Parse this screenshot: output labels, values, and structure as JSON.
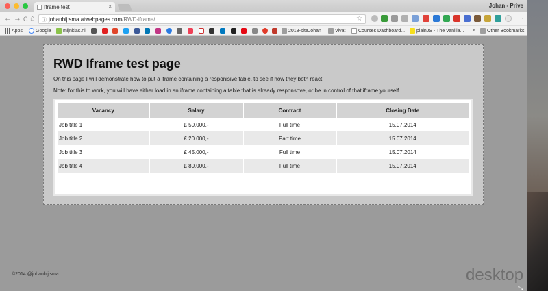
{
  "browser": {
    "tab_title": "Iframe test",
    "tab_close": "×",
    "profile_name": "Johan - Prive",
    "url_host": "johanbijlsma.atwebpages.com",
    "url_path": "/RWD-iframe/",
    "nav_back": "←",
    "nav_forward": "→",
    "nav_reload": "C",
    "nav_home": "⌂",
    "star": "☆",
    "menu": "⋮"
  },
  "bookmarks": {
    "apps": "Apps",
    "google": "Google",
    "mijnklas": "mijnklas.nl",
    "site_johan": "2018-siteJohan",
    "vivat": "Vivat",
    "courses": "Courses Dashboard...",
    "plainjs": "plainJS - The Vanilla...",
    "more": "»",
    "other": "Other Bookmarks"
  },
  "page": {
    "heading": "RWD Iframe test page",
    "intro": "On this page I will demonstrate how to put a iframe containing a responisive table, to see if how they both react.",
    "note": "Note: for this to work, you will have either load in an iframe containing a table that is already responsove, or be in control of that iframe yourself.",
    "table": {
      "headers": [
        "Vacancy",
        "Salary",
        "Contract",
        "Closing Date"
      ],
      "rows": [
        [
          "Job title 1",
          "£ 50.000,-",
          "Full time",
          "15.07.2014"
        ],
        [
          "Job title 2",
          "£ 20.000,-",
          "Part time",
          "15.07.2014"
        ],
        [
          "Job title 3",
          "£ 45.000,-",
          "Full time",
          "15.07.2014"
        ],
        [
          "Job title 4",
          "£ 80.000,-",
          "Full time",
          "15.07.2014"
        ]
      ]
    },
    "footer": "©2014 @johanbijlsma",
    "watermark": "desktop"
  },
  "colors": {
    "page_bg": "#9b9b9b",
    "frame_bg": "#c9c9c9",
    "header_bg": "#d3d3d3",
    "alt_row_bg": "#e9e9e9"
  }
}
